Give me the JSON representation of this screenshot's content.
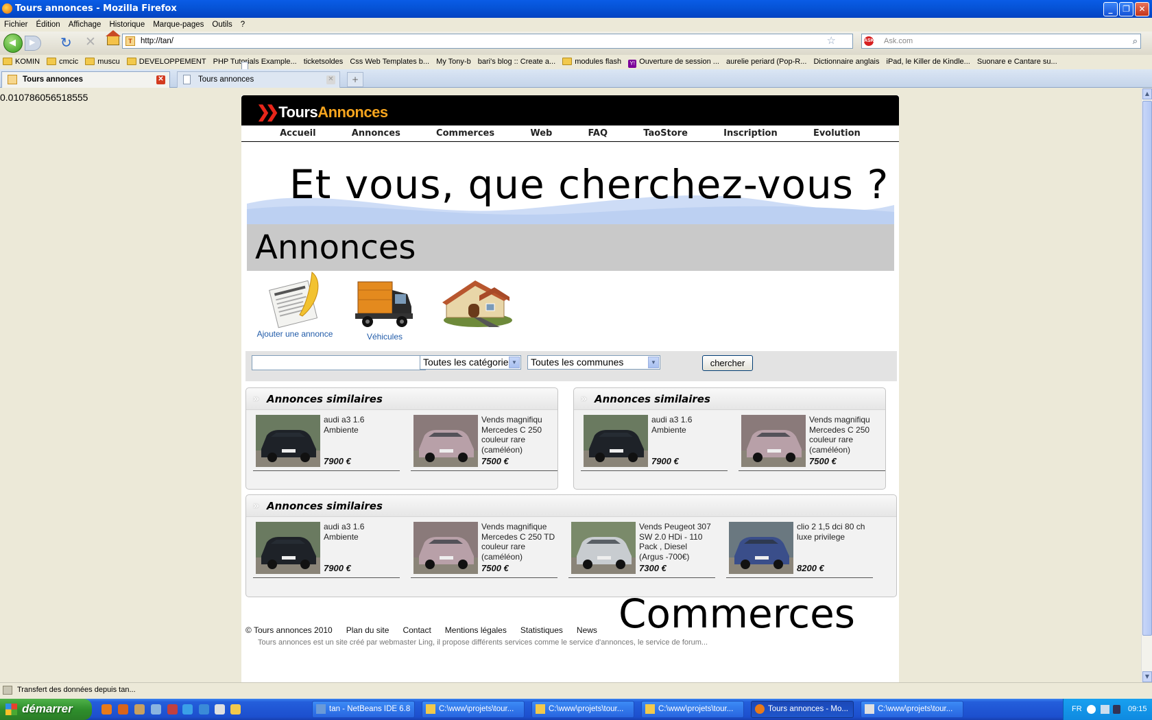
{
  "window": {
    "title": "Tours annonces - Mozilla Firefox"
  },
  "menu": [
    "Fichier",
    "Édition",
    "Affichage",
    "Historique",
    "Marque-pages",
    "Outils",
    "?"
  ],
  "address": {
    "url": "http://tan/",
    "search_placeholder": "Ask.com"
  },
  "bookmarks": [
    {
      "label": "KOMIN",
      "icon": "folder"
    },
    {
      "label": "cmcic",
      "icon": "folder"
    },
    {
      "label": "muscu",
      "icon": "folder"
    },
    {
      "label": "DEVELOPPEMENT",
      "icon": "folder"
    },
    {
      "label": "PHP Tutorials Example...",
      "icon": "page"
    },
    {
      "label": "ticketsoldes",
      "icon": "page"
    },
    {
      "label": "Css Web Templates b...",
      "icon": "page"
    },
    {
      "label": "My Tony-b",
      "icon": "page"
    },
    {
      "label": "bari's blog :: Create a...",
      "icon": "page"
    },
    {
      "label": "modules flash",
      "icon": "folder"
    },
    {
      "label": "Ouverture de session ...",
      "icon": "yahoo"
    },
    {
      "label": "aurelie periard (Pop-R...",
      "icon": "page"
    },
    {
      "label": "Dictionnaire anglais",
      "icon": "page"
    },
    {
      "label": "iPad, le Killer de Kindle...",
      "icon": "page"
    },
    {
      "label": "Suonare e Cantare su...",
      "icon": "page"
    }
  ],
  "tabs": [
    {
      "label": "Tours annonces",
      "active": true
    },
    {
      "label": "Tours annonces",
      "active": false
    }
  ],
  "debug_value": "0.010786056518555",
  "site": {
    "logo_part1": "Tours",
    "logo_part2": "Annonces",
    "nav": [
      "Accueil",
      "Annonces",
      "Commerces",
      "Web",
      "FAQ",
      "TaoStore",
      "Inscription",
      "Evolution"
    ],
    "hero": "Et vous, que cherchez-vous ?",
    "section_title": "Annonces",
    "icon_links": [
      {
        "label": "Ajouter une annonce",
        "icon": "blog-notepad-icon"
      },
      {
        "label": "Véhicules",
        "icon": "truck-icon"
      },
      {
        "label": "",
        "icon": "house-icon"
      }
    ],
    "search": {
      "input_value": "",
      "category": "Toutes les catégories",
      "commune": "Toutes les communes",
      "button": "chercher"
    },
    "boxes": [
      {
        "title": "Annonces similaires",
        "items": [
          {
            "desc": "audi a3 1.6 Ambiente",
            "price": "7900 €",
            "car": "dark"
          },
          {
            "desc": "Vends magnifiqu Mercedes C 250 couleur rare (caméléon)",
            "price": "7500 €",
            "car": "pink"
          }
        ]
      },
      {
        "title": "Annonces similaires",
        "items": [
          {
            "desc": "audi a3 1.6 Ambiente",
            "price": "7900 €",
            "car": "dark"
          },
          {
            "desc": "Vends magnifiqu Mercedes C 250 couleur rare (caméléon)",
            "price": "7500 €",
            "car": "pink"
          }
        ]
      },
      {
        "title": "Annonces similaires",
        "items": [
          {
            "desc": "audi a3 1.6 Ambiente",
            "price": "7900 €",
            "car": "dark"
          },
          {
            "desc": "Vends magnifique Mercedes C 250 TD couleur rare (caméléon)",
            "price": "7500 €",
            "car": "pink"
          },
          {
            "desc": "Vends Peugeot 307 SW 2.0 HDi - 110 Pack , Diesel (Argus -700€)",
            "price": "7300 €",
            "car": "silver"
          },
          {
            "desc": "clio 2 1,5 dci 80 ch luxe privilege",
            "price": "8200 €",
            "car": "blue"
          }
        ]
      }
    ],
    "commerces_title": "Commerces",
    "footer": [
      "© Tours annonces 2010",
      "Plan du site",
      "Contact",
      "Mentions légales",
      "Statistiques",
      "News"
    ],
    "footer_cut": "Tours annonces est un site créé par webmaster Ling, il propose différents services comme le service d'annonces, le service de forum..."
  },
  "status": "Transfert des données depuis tan...",
  "taskbar": {
    "start": "démarrer",
    "tasks": [
      {
        "label": "tan - NetBeans IDE 6.8",
        "active": false
      },
      {
        "label": "C:\\www\\projets\\tour...",
        "active": false
      },
      {
        "label": "C:\\www\\projets\\tour...",
        "active": false
      },
      {
        "label": "C:\\www\\projets\\tour...",
        "active": false
      },
      {
        "label": "Tours annonces - Mo...",
        "active": true
      },
      {
        "label": "C:\\www\\projets\\tour...",
        "active": false
      }
    ],
    "lang": "FR",
    "clock": "09:15"
  }
}
